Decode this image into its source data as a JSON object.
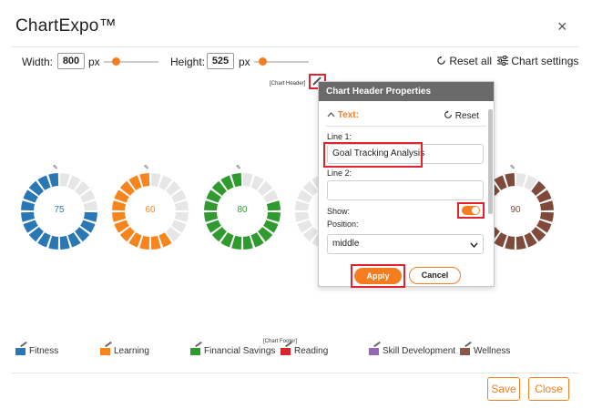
{
  "app": {
    "title": "ChartExpo™",
    "close_glyph": "×"
  },
  "toolbar": {
    "width_label": "Width:",
    "width_value": "800",
    "width_unit": "px",
    "height_label": "Height:",
    "height_value": "525",
    "height_unit": "px",
    "reset_all_label": "Reset all",
    "chart_settings_label": "Chart settings"
  },
  "chart": {
    "header_tag": "[Chart Header]",
    "footer_tag": "[Chart Footer]",
    "donuts": [
      {
        "value": "75",
        "color": "#2a77b6"
      },
      {
        "value": "60",
        "color": "#f7841c"
      },
      {
        "value": "80",
        "color": "#2f9a2e"
      },
      {
        "value": "",
        "color": "#cccccc"
      },
      {
        "value": "90",
        "color": "#7f4a3a"
      }
    ],
    "legend": [
      {
        "label": "Fitness",
        "color": "#2a77b6"
      },
      {
        "label": "Learning",
        "color": "#f7841c"
      },
      {
        "label": "Financial Savings",
        "color": "#2f9a2e"
      },
      {
        "label": "Reading",
        "color": "#d7262b"
      },
      {
        "label": "Skill Development",
        "color": "#9467bd"
      },
      {
        "label": "Wellness",
        "color": "#8c564b"
      }
    ]
  },
  "panel": {
    "title": "Chart Header Properties",
    "section_label": "Text:",
    "section_reset": "Reset",
    "line1_label": "Line 1:",
    "line1_value": "Goal Tracking Analysis",
    "line2_label": "Line 2:",
    "line2_value": "",
    "show_label": "Show:",
    "position_label": "Position:",
    "position_value": "middle",
    "apply_label": "Apply",
    "cancel_label": "Cancel"
  },
  "footer": {
    "save_label": "Save",
    "close_label": "Close"
  },
  "colors": {
    "accent": "#f47d20",
    "highlight": "#e0232f",
    "panel_header": "#6a6a6a"
  }
}
